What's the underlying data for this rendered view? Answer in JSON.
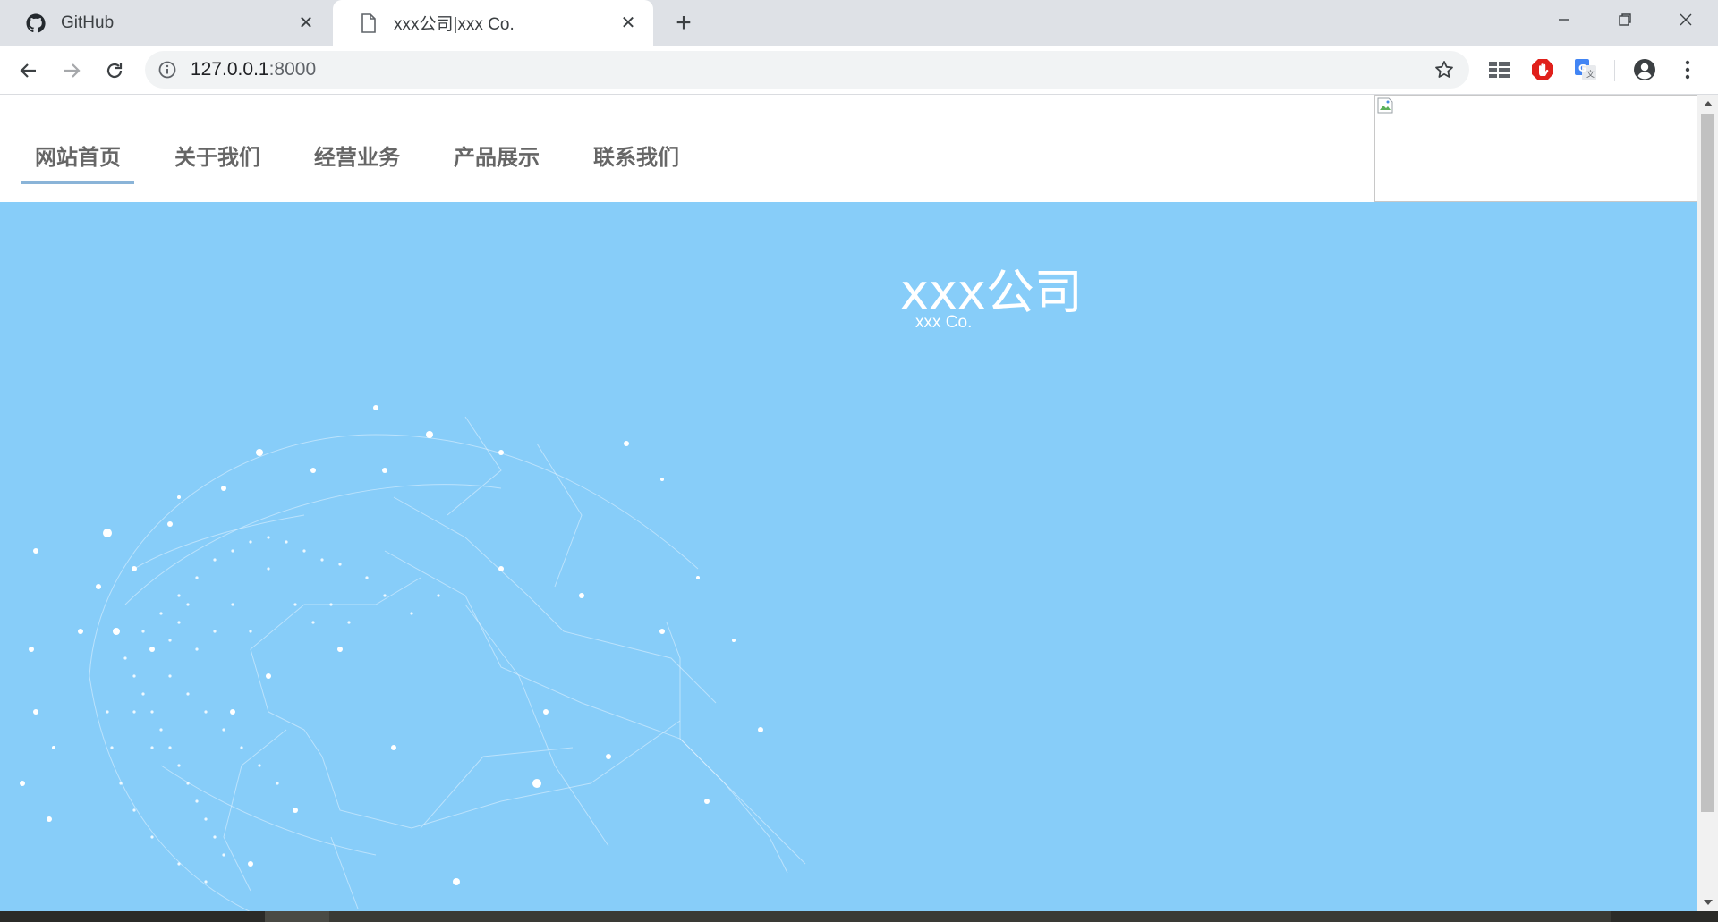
{
  "browser": {
    "tabs": [
      {
        "title": "GitHub",
        "icon": "github-icon"
      },
      {
        "title": "xxx公司|xxx Co.",
        "icon": "page-icon",
        "active": true
      }
    ],
    "close_glyph": "✕",
    "new_tab_glyph": "+",
    "url_host": "127.0.0.1",
    "url_port": ":8000"
  },
  "site": {
    "nav": [
      {
        "label": "网站首页",
        "active": true
      },
      {
        "label": "关于我们"
      },
      {
        "label": "经营业务"
      },
      {
        "label": "产品展示"
      },
      {
        "label": "联系我们"
      }
    ],
    "hero_title": "xxx公司",
    "hero_subtitle": "xxx Co.",
    "hero_color": "#87cdf9"
  }
}
